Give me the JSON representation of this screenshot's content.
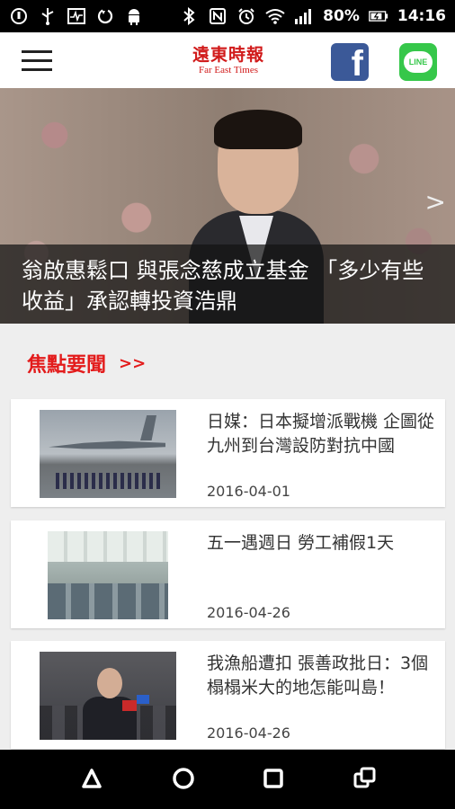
{
  "status_bar": {
    "battery_percent": "80%",
    "time": "14:16"
  },
  "header": {
    "logo_cn": "遠東時報",
    "logo_en": "Far East Times",
    "line_label": "LINE",
    "facebook_letter": "f"
  },
  "hero": {
    "caption": "翁啟惠鬆口 與張念慈成立基金 「多少有些收益」承認轉投資浩鼎",
    "next_arrow": ">"
  },
  "section": {
    "title": "焦點要聞",
    "more": ">>"
  },
  "articles": [
    {
      "title": "日媒：日本擬增派戰機 企圖從九州到台灣設防對抗中國",
      "date": "2016-04-01"
    },
    {
      "title": "五一遇週日 勞工補假1天",
      "date": "2016-04-26"
    },
    {
      "title": "我漁船遭扣 張善政批日：3個榻榻米大的地怎能叫島！",
      "date": "2016-04-26"
    }
  ],
  "colors": {
    "brand_red": "#e31b1b",
    "facebook_blue": "#3b5998",
    "line_green": "#36c74a"
  }
}
